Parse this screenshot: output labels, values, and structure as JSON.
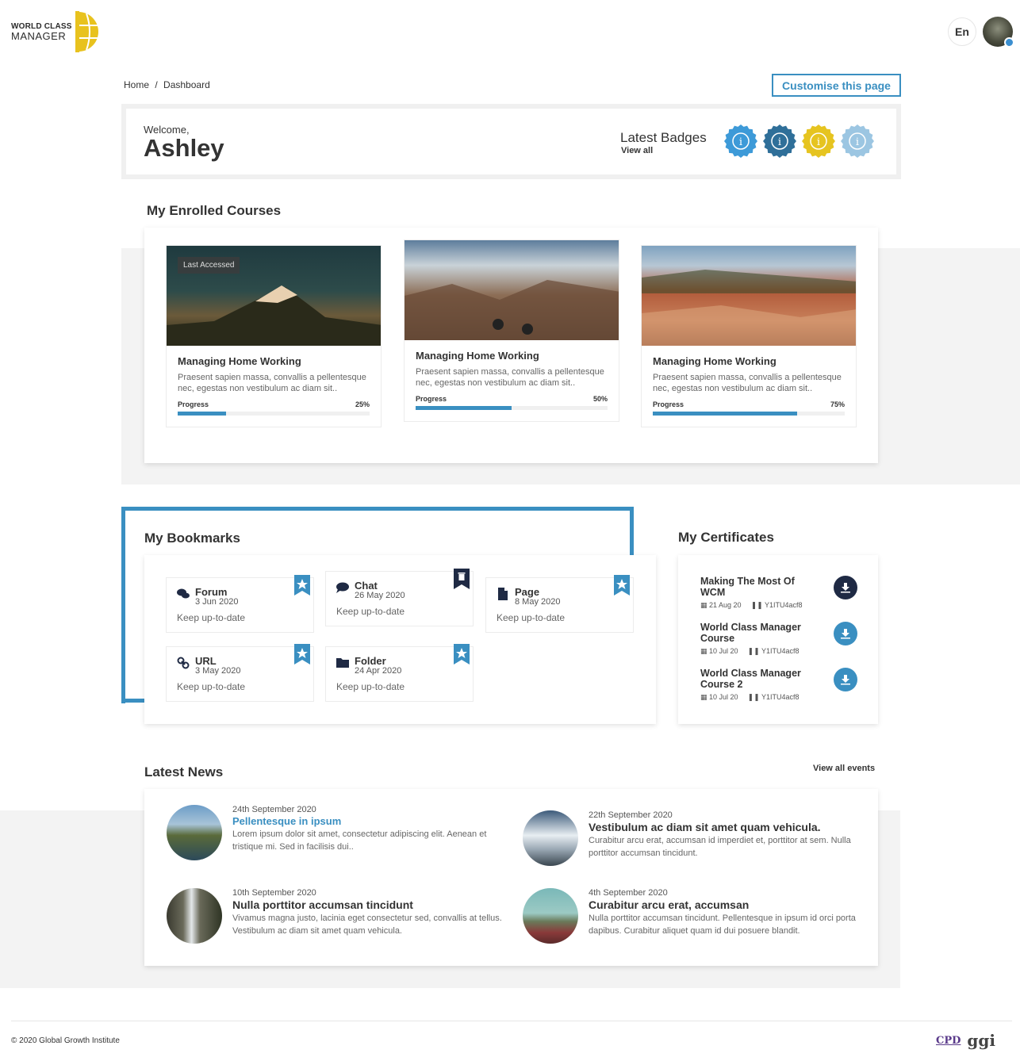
{
  "header": {
    "logo_line1": "WORLD CLASS",
    "logo_line2": "MANAGER",
    "language": "En"
  },
  "breadcrumb": [
    "Home",
    "/",
    "Dashboard"
  ],
  "customise_label": "Customise this page",
  "welcome": {
    "greeting": "Welcome,",
    "name": "Ashley"
  },
  "badges": {
    "title": "Latest Badges",
    "view_all": "View all",
    "colors": [
      "#3d9ad8",
      "#2f6f99",
      "#e6c420",
      "#9cc6e2"
    ]
  },
  "courses": {
    "title": "My Enrolled Courses",
    "progress_label": "Progress",
    "last_accessed": "Last Accessed",
    "items": [
      {
        "title": "Managing Home Working",
        "desc": "Praesent sapien massa, convallis a pellentesque nec, egestas non vestibulum ac diam sit..",
        "progress_text": "25%",
        "progress": 0.25
      },
      {
        "title": "Managing Home Working",
        "desc": "Praesent sapien massa, convallis a pellentesque nec, egestas non vestibulum ac diam sit..",
        "progress_text": "50%",
        "progress": 0.5
      },
      {
        "title": "Managing Home Working",
        "desc": "Praesent sapien massa, convallis a pellentesque nec, egestas non vestibulum ac diam sit..",
        "progress_text": "75%",
        "progress": 0.75
      }
    ]
  },
  "bookmarks": {
    "title": "My Bookmarks",
    "items": [
      {
        "type": "Forum",
        "date": "3 Jun 2020",
        "desc": "Keep up-to-date",
        "icon": "forum-icon"
      },
      {
        "type": "Chat",
        "date": "26 May 2020",
        "desc": "Keep up-to-date",
        "icon": "chat-icon"
      },
      {
        "type": "Page",
        "date": "8 May 2020",
        "desc": "Keep up-to-date",
        "icon": "page-icon"
      },
      {
        "type": "URL",
        "date": "3 May 2020",
        "desc": "Keep up-to-date",
        "icon": "link-icon"
      },
      {
        "type": "Folder",
        "date": "24 Apr 2020",
        "desc": "Keep up-to-date",
        "icon": "folder-icon"
      }
    ]
  },
  "certificates": {
    "title": "My Certificates",
    "items": [
      {
        "title": "Making The Most Of WCM",
        "date": "21 Aug 20",
        "code": "Y1ITU4acf8",
        "icon_color": "#1f2a44"
      },
      {
        "title": "World Class Manager Course",
        "date": "10 Jul 20",
        "code": "Y1ITU4acf8",
        "icon_color": "#3a8fc1"
      },
      {
        "title": "World Class Manager Course 2",
        "date": "10 Jul 20",
        "code": "Y1ITU4acf8",
        "icon_color": "#3a8fc1"
      }
    ]
  },
  "news": {
    "title": "Latest News",
    "view_all": "View all events",
    "items": [
      {
        "date": "24th September 2020",
        "title": "Pellentesque in ipsum",
        "text": "Lorem ipsum dolor sit amet, consectetur adipiscing elit. Aenean et tristique mi. Sed in facilisis dui..",
        "link": true
      },
      {
        "date": "22th September 2020",
        "title": "Vestibulum ac diam sit amet quam vehicula.",
        "text": "Curabitur arcu erat, accumsan id imperdiet et, porttitor at sem. Nulla porttitor accumsan tincidunt.",
        "link": false
      },
      {
        "date": "10th September 2020",
        "title": "Nulla porttitor accumsan tincidunt",
        "text": " Vivamus magna justo, lacinia eget consectetur sed, convallis at tellus. Vestibulum ac diam sit amet quam vehicula.",
        "link": false
      },
      {
        "date": "4th September 2020",
        "title": "Curabitur arcu erat, accumsan",
        "text": "Nulla porttitor accumsan tincidunt. Pellentesque in ipsum id orci porta dapibus. Curabitur aliquet quam id dui posuere blandit.",
        "link": false
      }
    ]
  },
  "footer": {
    "copyright": "© 2020 Global Growth Institute",
    "logo1": "CPD",
    "logo2": "ggi"
  },
  "colors": {
    "accent": "#3a8fc1",
    "logo_yellow": "#e8c21e",
    "dark_navy": "#1f2a44"
  }
}
